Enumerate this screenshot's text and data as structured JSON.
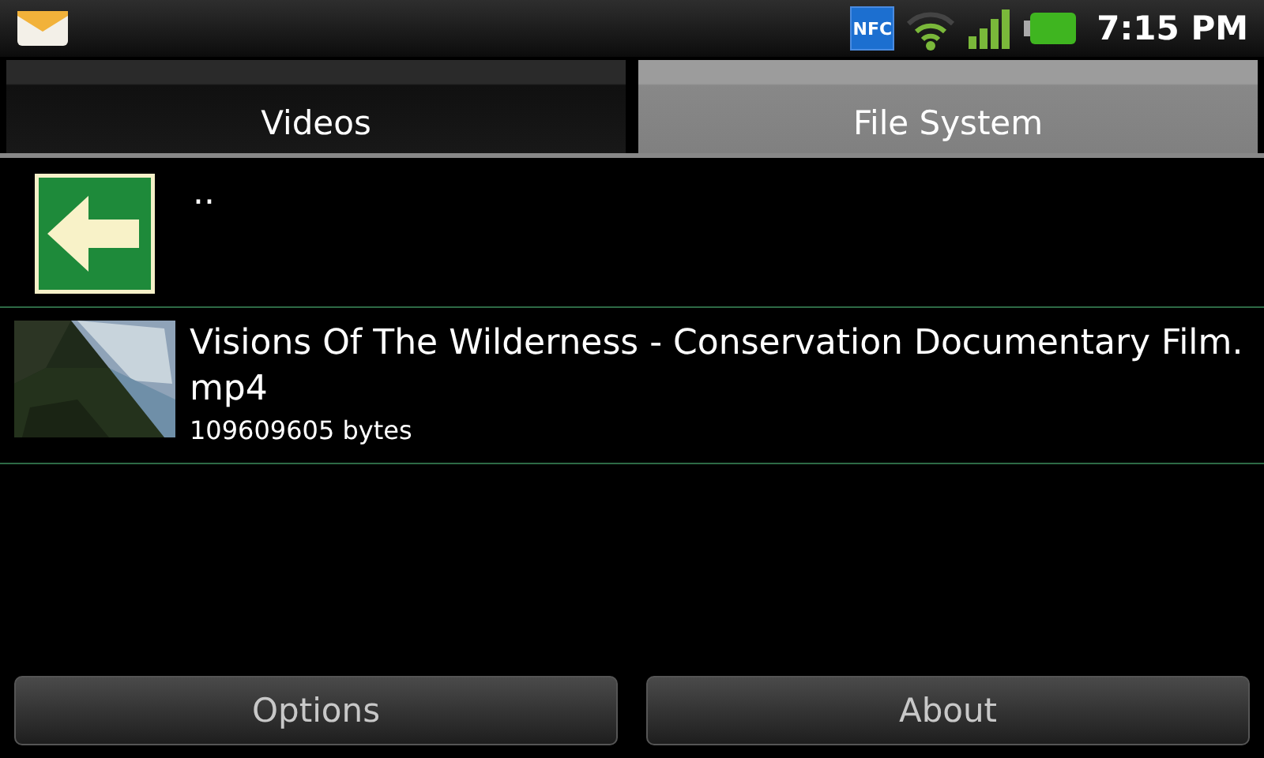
{
  "status_bar": {
    "nfc_label": "NFC",
    "time": "7:15 PM"
  },
  "tabs": [
    {
      "label": "Videos",
      "selected": false
    },
    {
      "label": "File System",
      "selected": true
    }
  ],
  "files": [
    {
      "kind": "parent",
      "name": ".."
    },
    {
      "kind": "video",
      "name": "Visions Of The Wilderness - Conservation Documentary Film.mp4",
      "size": "109609605 bytes"
    }
  ],
  "buttons": [
    "Options",
    "About"
  ]
}
